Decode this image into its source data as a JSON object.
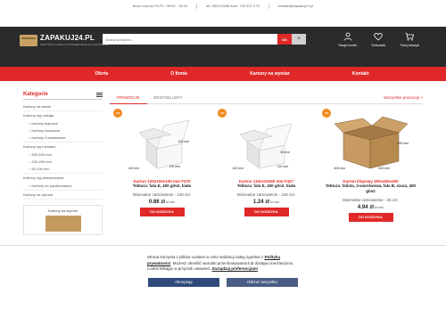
{
  "topbar": {
    "hours": "Biuro czynne Pn-Pt : 08:00 - 16:00",
    "phone": "tel. 655120286 kom. 730 571 273",
    "email": "kontakt@zapakuj24.pl"
  },
  "header": {
    "logo_text": "ZAPAKUJ24.PL",
    "logo_sub": "WSZYSTKO CZEGO POTRZEBUJESZ DO PAKOWANIA",
    "search_placeholder": "Szukaj produktu...",
    "search_ok": "OK",
    "search_plus": "+",
    "icons": [
      {
        "name": "user-icon",
        "label": "Twoje konto"
      },
      {
        "name": "heart-icon",
        "label": "Schowek"
      },
      {
        "name": "cart-icon",
        "label": "Twój koszyk"
      }
    ]
  },
  "nav": [
    "Oferta",
    "O firmie",
    "Kartony na wymiar",
    "Kontakt"
  ],
  "sidebar": {
    "title": "Kategorie",
    "c1": "Kartony na stanie",
    "c2": "Kartony wg rodzaju",
    "c2_items": [
      "Kartony klapowe",
      "Kartony fasonowe",
      "Kartony 3-warstwowe"
    ],
    "c3": "Kartony wg rozmiaru",
    "c3_items": [
      "300-500 mm",
      "200-299 mm",
      "50-199 mm"
    ],
    "c4": "Kartony wg zastosowania",
    "c4_items": [
      "Kartony do paczkomatów"
    ],
    "c5": "Kartony na wymiar",
    "ad_label": "Kartony na wymiar"
  },
  "tabs": {
    "promo": "PROMOCJE",
    "best": "BESTSELLERY",
    "more": "Wszystkie promocje »"
  },
  "products": [
    {
      "badge": "-5%",
      "name": "Karton 120x100x100 mm F470",
      "desc": "Tektura: fala E, 400 g/m2, biała",
      "dims": [
        "100 mm",
        "120 mm",
        "100 mm"
      ],
      "min": "Minimalne zamówienie - 100 szt.",
      "price": "0.86 zł",
      "price_unit": "brutto",
      "btn": "DO KOSZYKA"
    },
    {
      "badge": "-5%",
      "name": "Karton 110x110x80 mm F427",
      "desc": "Tektura: fala E, 400 g/m2, biała",
      "dims": [
        "80 mm",
        "110 mm",
        "110 mm"
      ],
      "min": "Minimalne zamówienie - 100 szt.",
      "price": "1.24 zł",
      "price_unit": "brutto",
      "btn": "DO KOSZYKA"
    },
    {
      "badge": "-5%",
      "name": "Karton klapowy 400x400x400",
      "desc": "Tektura: falista, 3-warstwowa, fala B, szara, 400 g/m2",
      "dims": [
        "400 mm",
        "400 mm",
        "400 mm"
      ],
      "min": "Minimalne zamówienie - 25 szt.",
      "price": "4.94 zł",
      "price_unit": "brutto",
      "btn": "DO KOSZYKA"
    }
  ],
  "cookie": {
    "text1": "Strona korzysta z plików cookies w celu realizacji usług zgodnie z",
    "link1": "Polityką prywatności",
    "text2": ". Możesz określić warunki przechowywania lub dostępu mechanizmu cookie klikając w przycisk ustawień.",
    "link2": "Zarządzaj preferencjami",
    "accept": "Akceptuję",
    "reject": "Odrzuć wszystko"
  },
  "colors": {
    "accent": "#e02828",
    "header_bg": "#2b2b2b",
    "badge": "#f08a1c",
    "cookie_btn": "#2f4a7a"
  }
}
